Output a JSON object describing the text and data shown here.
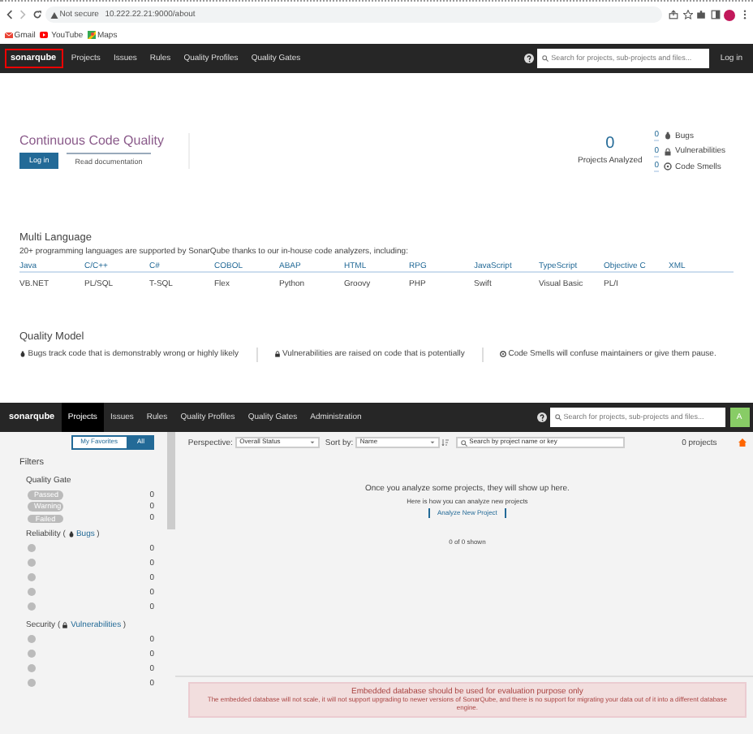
{
  "browser": {
    "security": "Not secure",
    "url": "10.222.22.21:9000/about",
    "bookmarks": [
      {
        "label": "Gmail",
        "kind": "mail"
      },
      {
        "label": "YouTube",
        "kind": "video"
      },
      {
        "label": "Maps",
        "kind": "maps"
      }
    ]
  },
  "about_page": {
    "navbar": {
      "logo": "sonarqube",
      "items": [
        {
          "label": "Projects",
          "selected": false
        },
        {
          "label": "Issues",
          "selected": false
        },
        {
          "label": "Rules",
          "selected": false
        },
        {
          "label": "Quality Profiles",
          "selected": false
        },
        {
          "label": "Quality Gates",
          "selected": false
        }
      ],
      "search": {
        "placeholder": "Search for projects, sub-projects and files..."
      },
      "login": "Log in"
    },
    "hero": {
      "title": "Continuous Code Quality",
      "buttons": [
        {
          "label": "Log in",
          "kind": "primary"
        },
        {
          "label": "Read documentation",
          "kind": "secondary"
        }
      ],
      "projects_count": "0",
      "projects_label": "Projects Analyzed",
      "measures": [
        {
          "value": "0",
          "label": "Bugs",
          "kind": "bug"
        },
        {
          "value": "0",
          "label": "Vulnerabilities",
          "kind": "lock"
        },
        {
          "value": "0",
          "label": "Code Smells",
          "kind": "smell"
        }
      ]
    },
    "languages": {
      "title": "Multi Language",
      "intro": "20+ programming languages are supported by SonarQube thanks to our in-house code analyzers, including:",
      "rows": [
        [
          "Java",
          "C/C++",
          "C#",
          "COBOL",
          "ABAP",
          "HTML",
          "RPG",
          "JavaScript",
          "TypeScript",
          "Objective C",
          "XML"
        ],
        [
          "VB.NET",
          "PL/SQL",
          "T-SQL",
          "Flex",
          "Python",
          "Groovy",
          "PHP",
          "Swift",
          "Visual Basic",
          "PL/I"
        ]
      ]
    },
    "quality_model": {
      "title": "Quality Model",
      "items": [
        {
          "kind": "bug",
          "text": "Bugs track code that is demonstrably wrong or highly likely"
        },
        {
          "kind": "lock",
          "text": "Vulnerabilities are raised on code that is potentially"
        },
        {
          "kind": "smell",
          "text": "Code Smells will confuse maintainers or give them pause."
        }
      ]
    }
  },
  "projects_page": {
    "navbar": {
      "logo": "sonarqube",
      "items": [
        {
          "label": "Projects",
          "selected": true
        },
        {
          "label": "Issues",
          "selected": false
        },
        {
          "label": "Rules",
          "selected": false
        },
        {
          "label": "Quality Profiles",
          "selected": false
        },
        {
          "label": "Quality Gates",
          "selected": false
        },
        {
          "label": "Administration",
          "selected": false
        }
      ],
      "search": {
        "placeholder": "Search for projects, sub-projects and files..."
      },
      "avatar": "A"
    },
    "sidebar": {
      "toggle": [
        {
          "label": "My Favorites",
          "selected": false
        },
        {
          "label": "All",
          "selected": true
        }
      ],
      "title": "Filters",
      "quality_gate": {
        "title": "Quality Gate",
        "items": [
          {
            "label": "Passed",
            "count": "0"
          },
          {
            "label": "Warning",
            "count": "0"
          },
          {
            "label": "Failed",
            "count": "0"
          }
        ]
      },
      "facets": [
        {
          "title": "Reliability (",
          "kind": "bug",
          "link": "Bugs",
          "suffix": ")",
          "counts": [
            "0",
            "0",
            "0",
            "0",
            "0"
          ]
        },
        {
          "title": "Security (",
          "kind": "lock",
          "link": "Vulnerabilities",
          "suffix": ")",
          "counts": [
            "0",
            "0",
            "0",
            "0"
          ]
        }
      ]
    },
    "toolbar": {
      "perspective_label": "Perspective:",
      "perspective": "Overall Status",
      "sort_label": "Sort by:",
      "sort": "Name",
      "search": {
        "placeholder": "Search by project name or key"
      },
      "count": "0 projects"
    },
    "empty": {
      "message": "Once you analyze some projects, they will show up here.",
      "hint": "Here is how you can analyze new projects",
      "button": "Analyze New Project",
      "shown": "0 of 0 shown"
    },
    "alert": {
      "title": "Embedded database should be used for evaluation purpose only",
      "text": "The embedded database will not scale, it will not support upgrading to newer versions of SonarQube, and there is no support for migrating your data out of it into a different database engine."
    }
  }
}
